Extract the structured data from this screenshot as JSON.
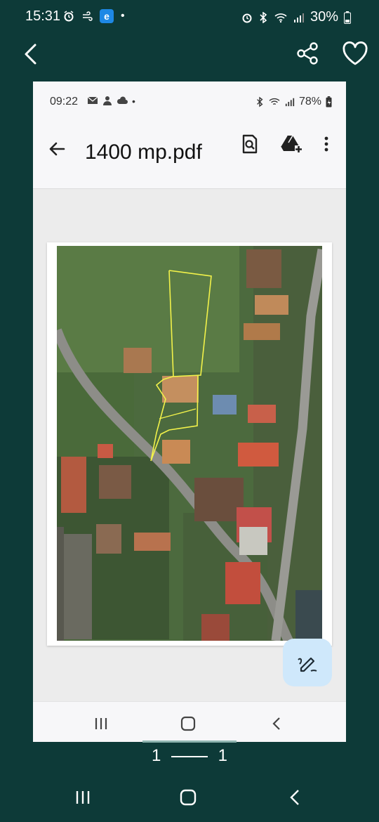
{
  "status_bar": {
    "time": "15:31",
    "notification_badge": "e",
    "dot": "•",
    "battery": "30%",
    "icons": [
      "alarm-icon",
      "wind-icon",
      "edge-app-icon",
      "alarm-icon",
      "bluetooth-icon",
      "wifi-icon",
      "signal-icon",
      "battery-icon"
    ]
  },
  "header": {
    "back_icon": "chevron-left-icon",
    "share_icon": "share-icon",
    "favorite_icon": "heart-icon"
  },
  "screenshot": {
    "status_bar": {
      "time": "09:22",
      "dot": "•",
      "battery": "78%"
    },
    "title": "1400 mp.pdf",
    "icons": [
      "back-arrow-icon",
      "search-document-icon",
      "drive-add-icon",
      "more-vert-icon",
      "edit-pen-icon"
    ]
  },
  "page_indicator": {
    "current": "1",
    "total": "1"
  }
}
